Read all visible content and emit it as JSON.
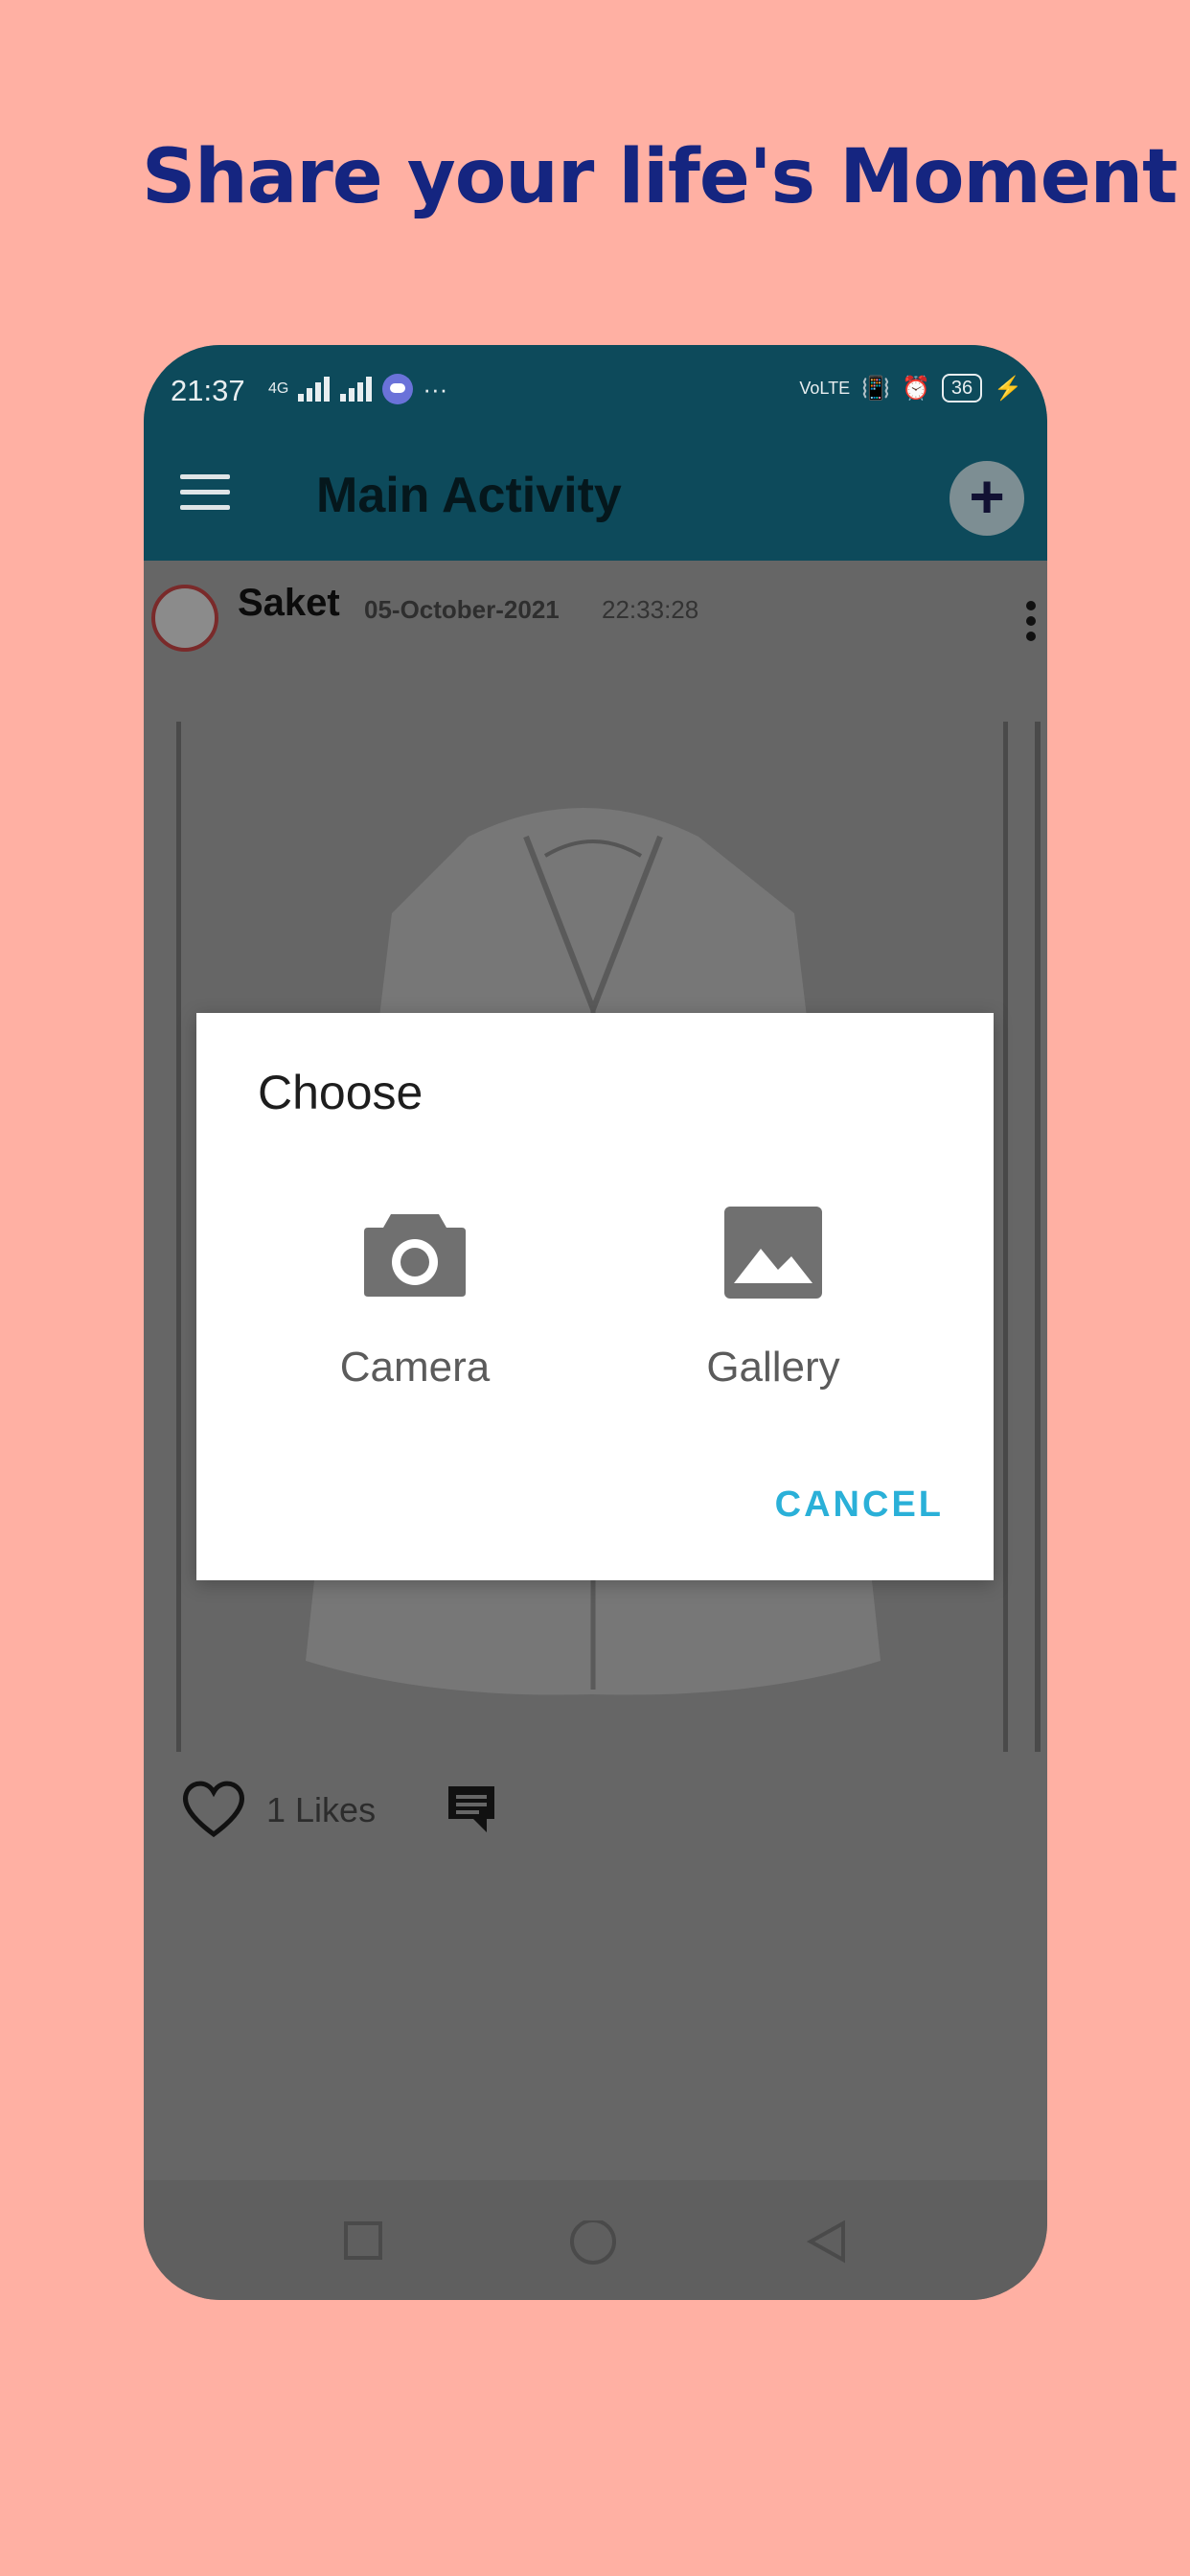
{
  "promo": {
    "headline": "Share your life's Moment"
  },
  "status_bar": {
    "time": "21:37",
    "net": "4G",
    "battery": "36",
    "volte": "VoLTE"
  },
  "app_bar": {
    "title": "Main Activity"
  },
  "post": {
    "user": "Saket",
    "date": "05-October-2021",
    "time": "22:33:28",
    "likes": "1 Likes"
  },
  "dialog": {
    "title": "Choose",
    "options": [
      {
        "label": "Camera",
        "icon": "camera-icon"
      },
      {
        "label": "Gallery",
        "icon": "gallery-icon"
      }
    ],
    "cancel_label": "CANCEL"
  },
  "colors": {
    "background": "#ffb0a3",
    "headline": "#152580",
    "app_bar": "#0d4a5b",
    "accent": "#2ab0d8"
  }
}
